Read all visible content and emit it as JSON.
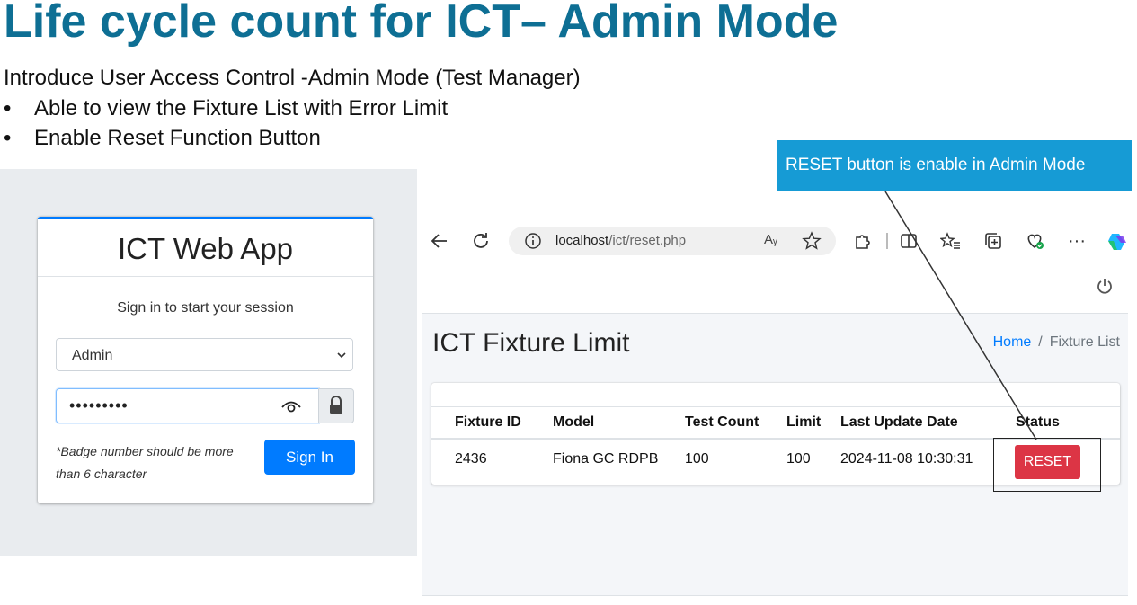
{
  "slide": {
    "title": "Life cycle count for ICT– Admin Mode",
    "intro": "Introduce User Access Control -Admin Mode (Test Manager)",
    "bullets": [
      "Able to view the Fixture List with Error Limit",
      "Enable Reset Function Button"
    ],
    "bullet_glyph": "•",
    "callout": "RESET button is enable in Admin Mode"
  },
  "login": {
    "app_title": "ICT Web App",
    "subtitle": "Sign in to start your session",
    "role_selected": "Admin",
    "password_masked": "•••••••••",
    "hint": "*Badge number should be more than 6 character",
    "signin_label": "Sign In"
  },
  "browser": {
    "url_host": "localhost",
    "url_path": "/ict/reset.php",
    "read_aloud_glyph": "Aᵧ"
  },
  "page": {
    "heading": "ICT Fixture Limit",
    "breadcrumb_home": "Home",
    "breadcrumb_sep": "/",
    "breadcrumb_current": "Fixture List"
  },
  "table": {
    "headers": [
      "Fixture ID",
      "Model",
      "Test Count",
      "Limit",
      "Last Update Date",
      "Status"
    ],
    "rows": [
      {
        "fixture_id": "2436",
        "model": "Fiona GC RDPB",
        "test_count": "100",
        "limit": "100",
        "last_update": "2024-11-08 10:30:31",
        "status_button": "RESET"
      }
    ]
  },
  "colors": {
    "title": "#0e6f94",
    "callout_bg": "#169bd5",
    "primary": "#007bff",
    "danger": "#dc3545"
  }
}
